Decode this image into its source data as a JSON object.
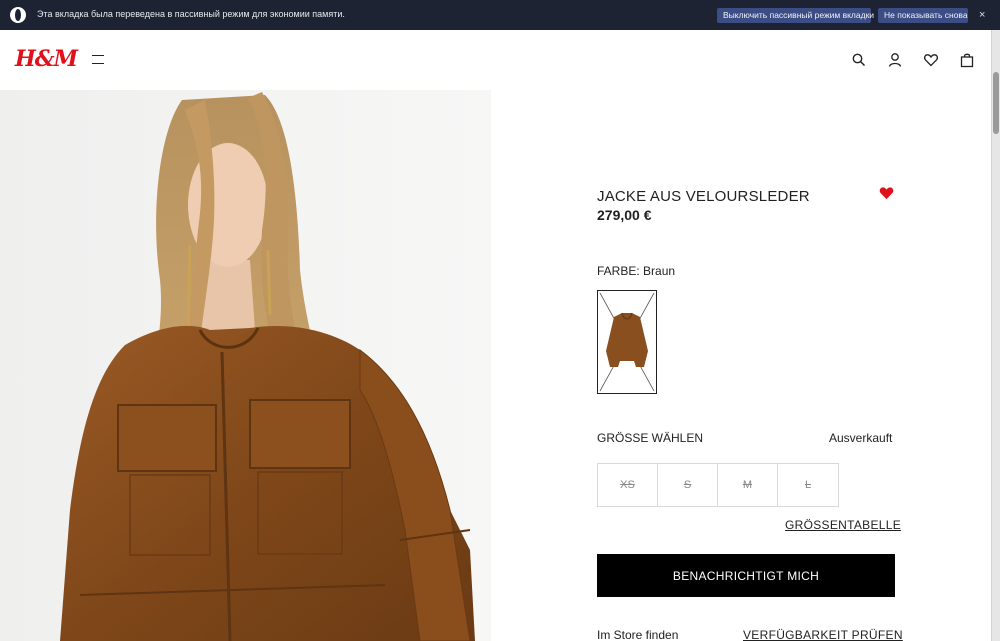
{
  "browser_banner": {
    "message": "Эта вкладка была переведена в пассивный режим для экономии памяти.",
    "disable_button": "Выключить пассивный режим вкладки",
    "dont_show_button": "Не показывать снова",
    "close_glyph": "×"
  },
  "header": {
    "logo": "H&M",
    "icons": [
      "menu-icon",
      "search-icon",
      "account-icon",
      "favorites-icon",
      "shopping-bag-icon"
    ]
  },
  "product": {
    "title": "JACKE AUS VELOURSLEDER",
    "price": "279,00 €",
    "favorite": true,
    "color_label": "FARBE: Braun",
    "size_heading": "GRÖSSE WÄHLEN",
    "availability": "Ausverkauft",
    "sizes": [
      "XS",
      "S",
      "M",
      "L"
    ],
    "size_table_link": "GRÖSSENTABELLE",
    "notify_button": "BENACHRICHTIGT MICH",
    "store_label": "Im Store finden",
    "check_availability_link": "VERFÜGBARKEIT PRÜFEN"
  },
  "colors": {
    "brand_red": "#e0111b",
    "banner_bg": "#1d2333",
    "banner_button": "#3c4d86",
    "suede_brown": "#8a4f1f"
  }
}
